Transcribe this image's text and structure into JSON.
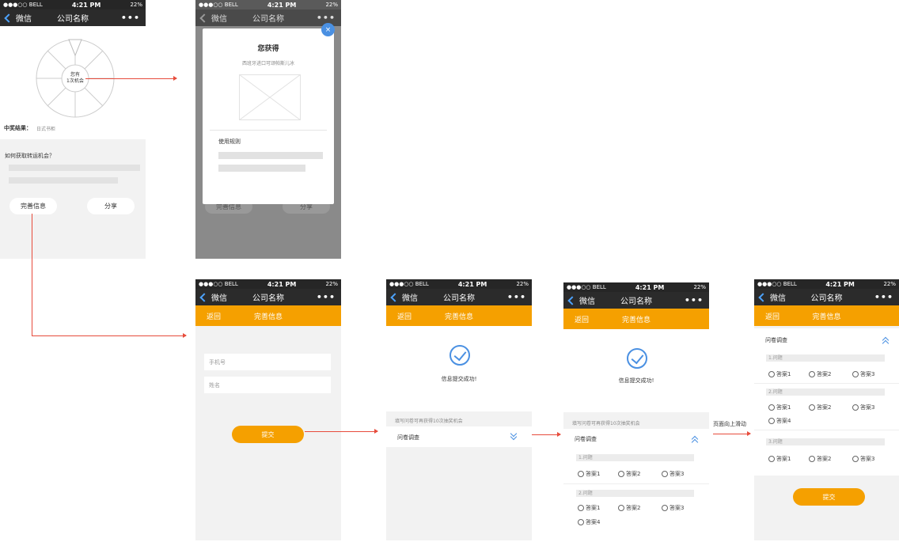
{
  "status": {
    "carrier": "●●●○○ BELL",
    "time": "4:21 PM",
    "battery": "22%"
  },
  "nav": {
    "back": "微信",
    "title": "公司名称",
    "more": "•••"
  },
  "s1": {
    "wheel_center": [
      "您有",
      "1次机会"
    ],
    "result_label": "中奖结果：",
    "result_value": "日式书柜",
    "how_title": "如何获取转运机会？",
    "btn_info": "完善信息",
    "btn_share": "分享"
  },
  "s2": {
    "modal_title": "您获得",
    "modal_subtitle": "西班牙进口可颂帕斯儿冰",
    "rules": "使用规则",
    "close": "×",
    "bg_btn_info": "完善信息",
    "bg_btn_share": "分享"
  },
  "form": {
    "back": "返回",
    "title": "完善信息",
    "phone_placeholder": "手机号",
    "name_placeholder": "姓名",
    "submit": "提交"
  },
  "success": {
    "message": "信息提交成功!",
    "hint": "填写问卷可再获得10次抽奖机会",
    "survey": "问卷调查"
  },
  "questions": [
    {
      "label": "1.问题",
      "options": [
        "答案1",
        "答案2",
        "答案3"
      ]
    },
    {
      "label": "2.问题",
      "options": [
        "答案1",
        "答案2",
        "答案3",
        "答案4"
      ]
    },
    {
      "label": "3.问题",
      "options": [
        "答案1",
        "答案2",
        "答案3"
      ]
    }
  ],
  "annotation": "页面向上滑动",
  "colors": {
    "orange": "#f5a000",
    "nav": "#2b2b2b",
    "blue": "#4a90e2",
    "arrow": "#e74c3c"
  }
}
